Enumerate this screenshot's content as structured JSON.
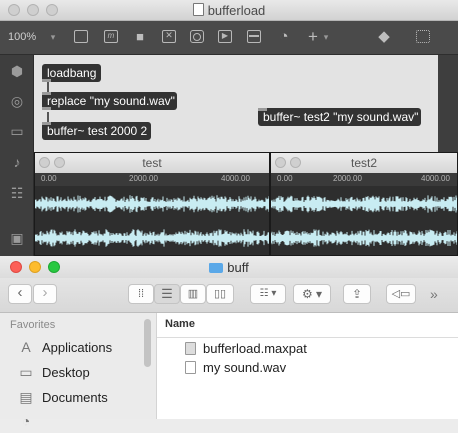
{
  "max_window": {
    "title": "bufferload",
    "zoom": "100%",
    "objects": {
      "loadbang": "loadbang",
      "replace": "replace \"my sound.wav\"",
      "buffer1": "buffer~ test 2000 2",
      "buffer2": "buffer~ test2 \"my sound.wav\""
    },
    "waveform_windows": [
      {
        "title": "test",
        "ticks": [
          "0.00",
          "2000.00",
          "4000.00"
        ]
      },
      {
        "title": "test2",
        "ticks": [
          "0.00",
          "2000.00",
          "4000.00"
        ]
      }
    ],
    "waveform_color": "#c8ecf2"
  },
  "finder": {
    "title": "buff",
    "sidebar": {
      "heading": "Favorites",
      "items": [
        "Applications",
        "Desktop",
        "Documents"
      ]
    },
    "column_header": "Name",
    "files": [
      {
        "name": "bufferload.maxpat",
        "icon": "maxpat-file-icon"
      },
      {
        "name": "my sound.wav",
        "icon": "audio-file-icon"
      }
    ]
  }
}
